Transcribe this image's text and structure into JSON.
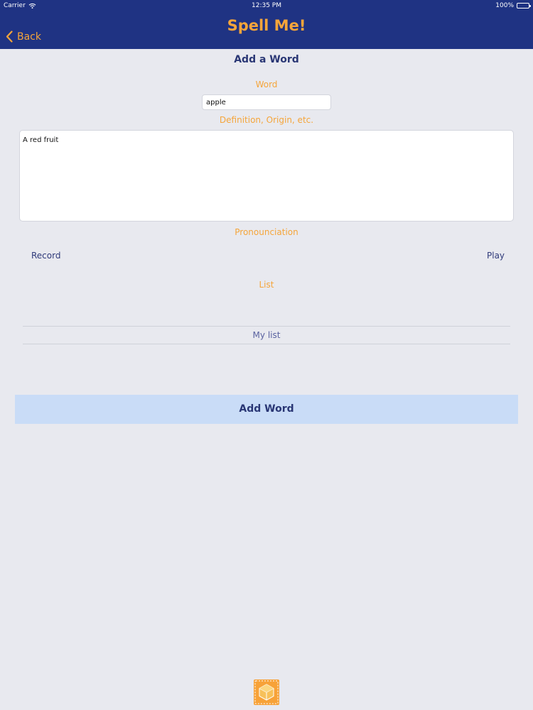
{
  "status_bar": {
    "carrier": "Carrier",
    "time": "12:35 PM",
    "battery": "100%"
  },
  "nav": {
    "back_label": "Back",
    "title": "Spell Me!"
  },
  "form": {
    "title": "Add a Word",
    "word_label": "Word",
    "word_value": "apple",
    "definition_label": "Definition, Origin, etc.",
    "definition_value": "A red fruit",
    "pronunciation_label": "Pronounciation",
    "record_label": "Record",
    "play_label": "Play",
    "list_label": "List",
    "list_selected": "My list",
    "submit_label": "Add Word"
  },
  "colors": {
    "nav_background": "#1f3383",
    "accent_orange": "#f5a53a",
    "button_background": "#c9dcf7",
    "page_background": "#e8e9ef"
  },
  "icons": {
    "back": "chevron-left-icon",
    "wifi": "wifi-icon",
    "battery": "battery-icon",
    "logo": "app-logo-icon"
  }
}
